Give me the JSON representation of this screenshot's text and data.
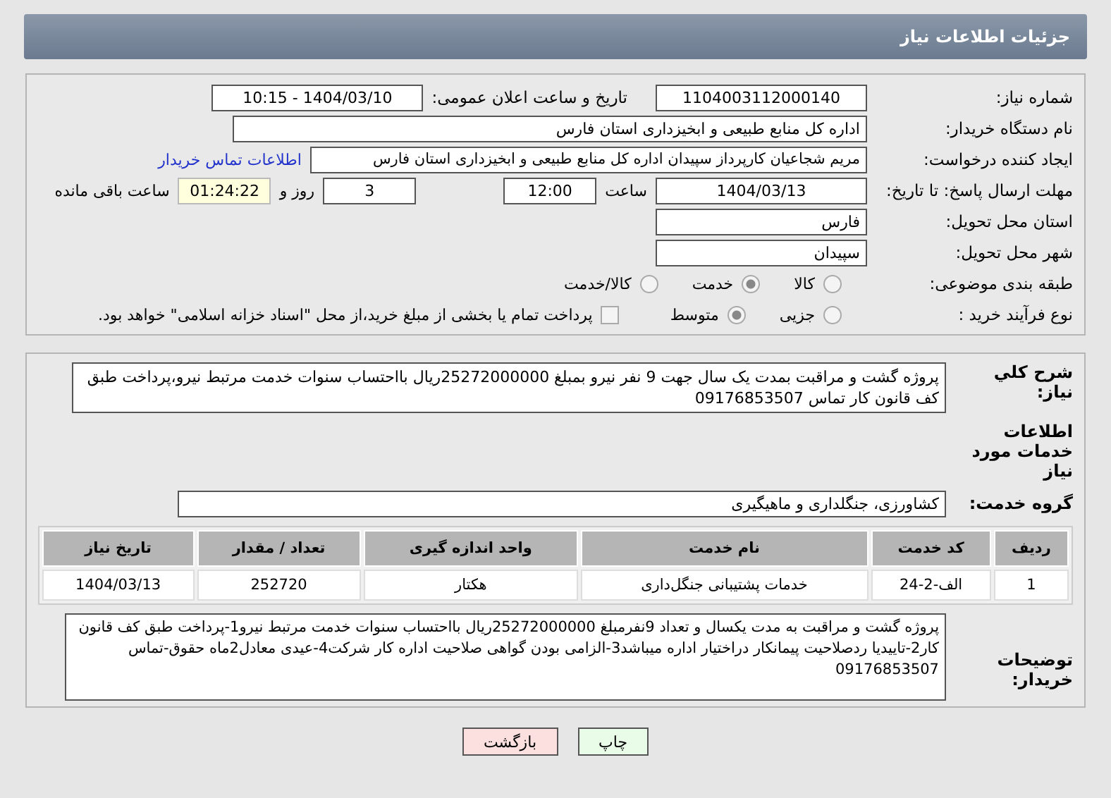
{
  "header": {
    "title": "جزئیات اطلاعات نیاز"
  },
  "fields": {
    "need_number": {
      "label": "شماره نیاز:",
      "value": "1104003112000140"
    },
    "announce": {
      "label": "تاریخ و ساعت اعلان عمومی:",
      "value": "1404/03/10 - 10:15"
    },
    "buyer": {
      "label": "نام دستگاه خریدار:",
      "value": "اداره کل منابع طبیعی و ابخیزداری استان فارس"
    },
    "creator": {
      "label": "ایجاد کننده درخواست:",
      "value": "مریم شجاعیان کارپرداز سپیدان اداره کل منابع طبیعی و ابخیزداری استان فارس",
      "link": "اطلاعات تماس خریدار"
    },
    "deadline": {
      "label": "مهلت ارسال پاسخ: تا تاریخ:",
      "date": "1404/03/13",
      "time_label": "ساعت",
      "time": "12:00",
      "days": "3",
      "days_label": "روز و",
      "remaining": "01:24:22",
      "remaining_label": "ساعت باقی مانده"
    },
    "province": {
      "label": "استان محل تحویل:",
      "value": "فارس"
    },
    "city": {
      "label": "شهر محل تحویل:",
      "value": "سپیدان"
    }
  },
  "category": {
    "label": "طبقه بندی موضوعی:",
    "options": [
      {
        "label": "کالا",
        "selected": false
      },
      {
        "label": "خدمت",
        "selected": true
      },
      {
        "label": "کالا/خدمت",
        "selected": false
      }
    ]
  },
  "process": {
    "label": "نوع فرآیند خرید :",
    "options": [
      {
        "label": "جزیی",
        "selected": false
      },
      {
        "label": "متوسط",
        "selected": true
      }
    ],
    "payment": {
      "label": "پرداخت تمام یا بخشی از مبلغ خرید،از محل \"اسناد خزانه اسلامی\" خواهد بود.",
      "checked": false
    }
  },
  "summary": {
    "label": "شرح کلي نياز:",
    "value": "پروژه گشت و مراقبت بمدت یک سال جهت 9 نفر نیرو بمبلغ 25272000000ریال بااحتساب سنوات خدمت مرتبط نیرو،پرداخت طبق کف قانون کار تماس 09176853507"
  },
  "services_title": "اطلاعات خدمات مورد نیاز",
  "service_group": {
    "label": "گروه خدمت:",
    "value": "کشاورزی، جنگلداری و ماهیگیری"
  },
  "table": {
    "columns": [
      "ردیف",
      "کد خدمت",
      "نام خدمت",
      "واحد اندازه گیری",
      "تعداد / مقدار",
      "تاریخ نیاز"
    ],
    "rows": [
      [
        "1",
        "الف-2-24",
        "خدمات پشتیبانی جنگل‌داری",
        "هکتار",
        "252720",
        "1404/03/13"
      ]
    ]
  },
  "buyer_notes": {
    "label": "توضیحات خریدار:",
    "value": "پروژه گشت و مراقبت به مدت یکسال و تعداد 9نفرمبلغ 25272000000ریال بااحتساب سنوات خدمت مرتبط نیرو1-پرداخت طبق کف قانون کار2-تاییدیا ردصلاحیت پیمانکار دراختیار اداره میباشد3-الزامی بودن گواهی صلاحیت اداره کار شرکت4-عیدی معادل2ماه حقوق-تماس 09176853507"
  },
  "buttons": [
    {
      "label": "چاپ",
      "kind": "print"
    },
    {
      "label": "بازگشت",
      "kind": "back"
    }
  ]
}
